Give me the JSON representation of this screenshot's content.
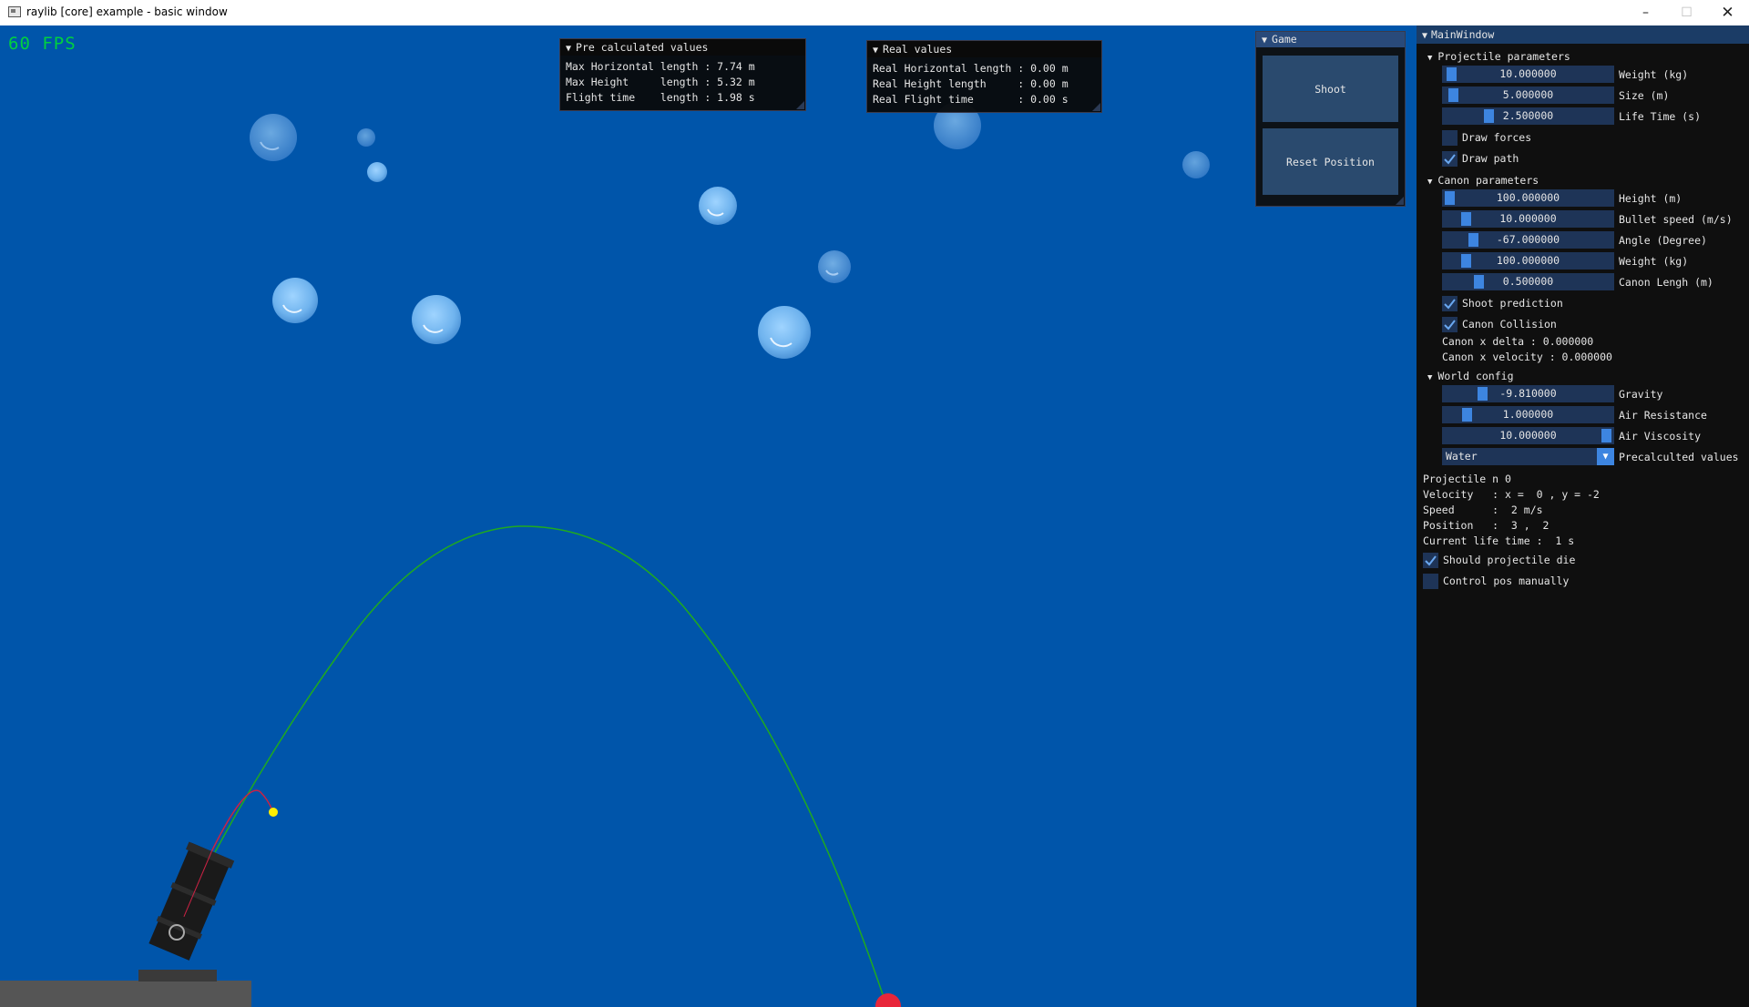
{
  "window": {
    "title": "raylib [core] example - basic window",
    "minimize_glyph": "–",
    "maximize_glyph": "☐",
    "close_glyph": "✕"
  },
  "scene": {
    "fps_text": "60 FPS",
    "background_color": "#0055aa"
  },
  "precalc_panel": {
    "title": "Pre calculated values",
    "lines": [
      "Max Horizontal length : 7.74 m",
      "Max Height     length : 5.32 m",
      "Flight time    length : 1.98 s"
    ]
  },
  "real_panel": {
    "title": "Real values",
    "lines": [
      "Real Horizontal length : 0.00 m",
      "Real Height length     : 0.00 m",
      "Real Flight time       : 0.00 s"
    ]
  },
  "game_panel": {
    "title": "Game",
    "shoot_label": "Shoot",
    "reset_label": "Reset Position"
  },
  "main_window": {
    "title": "MainWindow",
    "projectile": {
      "header": "Projectile parameters",
      "sliders": [
        {
          "value": "10.000000",
          "label": "Weight (kg)"
        },
        {
          "value": "5.000000",
          "label": "Size (m)"
        },
        {
          "value": "2.500000",
          "label": "Life Time (s)"
        }
      ],
      "draw_forces": {
        "label": "Draw forces",
        "checked": false
      },
      "draw_path": {
        "label": "Draw path",
        "checked": true
      }
    },
    "canon": {
      "header": "Canon parameters",
      "sliders": [
        {
          "value": "100.000000",
          "label": "Height (m)"
        },
        {
          "value": "10.000000",
          "label": "Bullet speed (m/s)"
        },
        {
          "value": "-67.000000",
          "label": "Angle (Degree)"
        },
        {
          "value": "100.000000",
          "label": "Weight (kg)"
        },
        {
          "value": "0.500000",
          "label": "Canon Lengh (m)"
        }
      ],
      "shoot_prediction": {
        "label": "Shoot prediction",
        "checked": true
      },
      "canon_collision": {
        "label": "Canon Collision",
        "checked": true
      },
      "x_delta": "Canon x delta : 0.000000",
      "x_velocity": "Canon x velocity : 0.000000"
    },
    "world": {
      "header": "World config",
      "sliders": [
        {
          "value": "-9.810000",
          "label": "Gravity"
        },
        {
          "value": "1.000000",
          "label": "Air Resistance"
        },
        {
          "value": "10.000000",
          "label": "Air Viscosity"
        }
      ],
      "combo_value": "Water",
      "combo_label": "Precalculted values"
    },
    "projectile_info": {
      "lines": [
        "Projectile n 0",
        "Velocity   : x =  0 , y = -2",
        "Speed      :  2 m/s",
        "Position   :  3 ,  2",
        "Current life time :  1 s"
      ],
      "should_die": {
        "label": "Should projectile die",
        "checked": true
      },
      "control_manual": {
        "label": "Control pos manually",
        "checked": false
      }
    }
  }
}
